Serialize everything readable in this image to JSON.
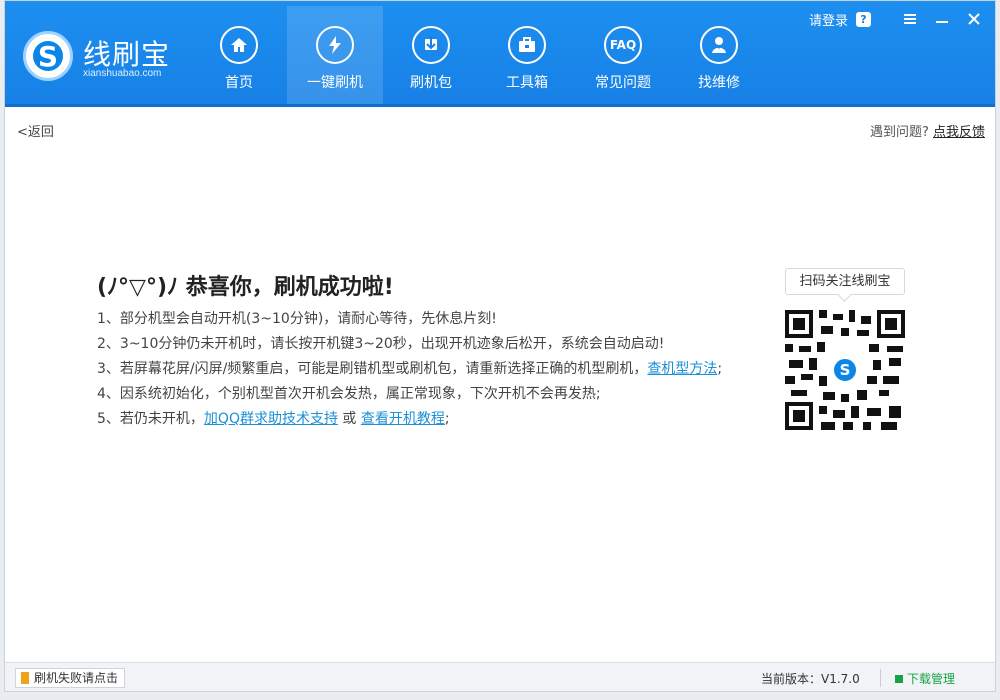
{
  "app": {
    "title": "线刷宝",
    "subtitle": "xianshuabao.com",
    "logo_letter": "S"
  },
  "header": {
    "login": "请登录",
    "help": "?"
  },
  "nav": {
    "items": [
      {
        "label": "首页",
        "icon": "home-icon"
      },
      {
        "label": "一键刷机",
        "icon": "lightning-icon",
        "active": true
      },
      {
        "label": "刷机包",
        "icon": "package-icon"
      },
      {
        "label": "工具箱",
        "icon": "toolbox-icon"
      },
      {
        "label": "常见问题",
        "icon": "faq-icon",
        "icon_text": "FAQ"
      },
      {
        "label": "找维修",
        "icon": "repair-person-icon"
      }
    ]
  },
  "page": {
    "back": "<返回",
    "feedback_prefix": "遇到问题?",
    "feedback_link": "点我反馈"
  },
  "success": {
    "title": "(ﾉ°▽°)ﾉ 恭喜你，刷机成功啦!",
    "line1": "1、部分机型会自动开机(3~10分钟)，请耐心等待，先休息片刻!",
    "line2": "2、3~10分钟仍未开机时，请长按开机键3~20秒，出现开机迹象后松开，系统会自动启动!",
    "line3_text": "3、若屏幕花屏/闪屏/频繁重启，可能是刷错机型或刷机包，请重新选择正确的机型刷机，",
    "line3_link": "查机型方法",
    "line3_end": ";",
    "line4": "4、因系统初始化，个别机型首次开机会发热，属正常现象，下次开机不会再发热;",
    "line5_prefix": "5、若仍未开机，",
    "line5_link1": "加QQ群求助技术支持",
    "line5_mid": " 或 ",
    "line5_link2": "查看开机教程",
    "line5_end": ";"
  },
  "qr": {
    "caption": "扫码关注线刷宝",
    "center_letter": "S"
  },
  "status": {
    "fail_button": "刷机失败请点击",
    "version": "当前版本：V1.7.0",
    "download_manager": "下载管理"
  },
  "colors": {
    "header_blue": "#1780e6",
    "link_blue": "#1b8fd8",
    "success_green": "#18a246"
  }
}
